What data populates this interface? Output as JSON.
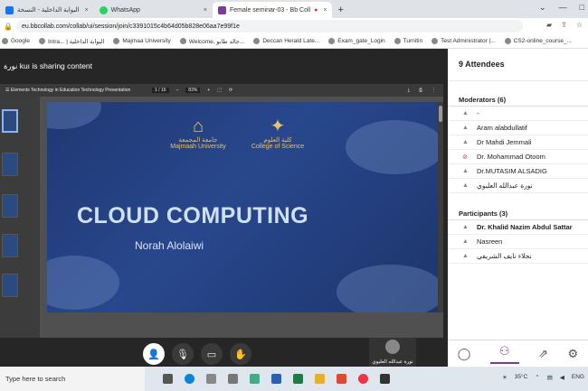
{
  "tabs": [
    {
      "title": "البوابة الداخلية - النسخة"
    },
    {
      "title": "WhatsApp"
    },
    {
      "title": "Female seminar-03 - Bb Coll"
    }
  ],
  "url": "eu.bbcollab.com/collab/ui/session/join/c3391015c4b64d05b828e06aa7e99f1e",
  "bookmarks": [
    "Google",
    "Intra... | البوابة الداخلية",
    "Majmaa University",
    "Welcome, جالد طابو...",
    "Deccan Herald Late...",
    "Exam_gate_Login",
    "Turnitin",
    "Test Administrator |...",
    "CS2-online_course_..."
  ],
  "sharing_text": "نورة kuı is sharing content",
  "viewer": {
    "doc_title": "Elements Technology in Education Technology Presentation",
    "page": "1 / 16",
    "zoom": "83%"
  },
  "slide": {
    "title": "CLOUD COMPUTING",
    "author": "Norah Alolaiwi",
    "logo1_text": "جامعة المجمعة\nMajmaah University",
    "logo2_text": "كلية العلوم\nCollege of Science"
  },
  "self_name": "نورة عبدالله العليوي",
  "panel": {
    "title": "9 Attendees",
    "moderators_header": "Moderators (6)",
    "moderators": [
      "-",
      "Aram alabdullatif",
      "Dr Mahdi Jemmali",
      "Dr. Mohammad Otoom",
      "Dr.MUTASIM ALSADIG",
      "نورة عبدالله العليوي"
    ],
    "participants_header": "Participants (3)",
    "participants": [
      "Dr. Khalid Nazim Abdul Sattar",
      "Nasreen",
      "نجلاء نايف الشريفي"
    ]
  },
  "taskbar": {
    "search": "Type here to search",
    "temp": "35°C",
    "lang": "ENG"
  }
}
